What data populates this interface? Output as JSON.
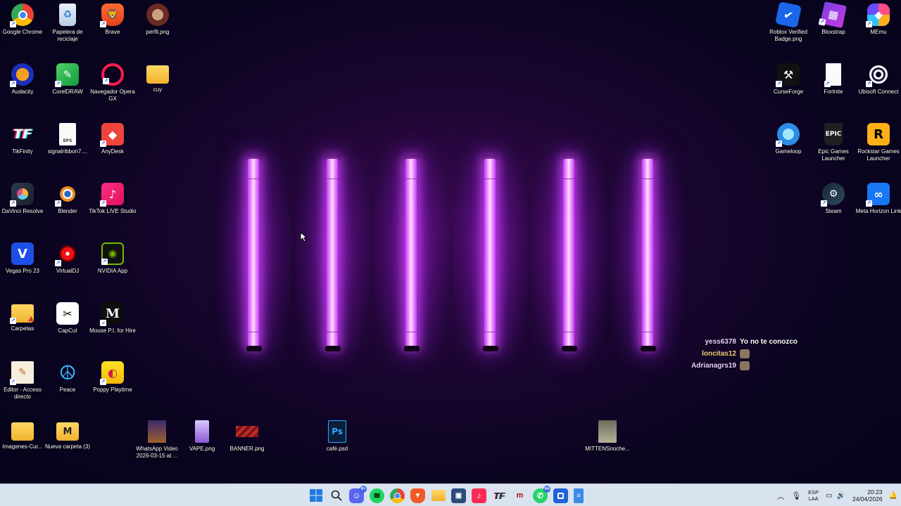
{
  "desktop": {
    "icons_left": [
      {
        "label": "Google Chrome",
        "icon": "chrome-icon"
      },
      {
        "label": "Papelera de reciclaje",
        "icon": "recycle-bin-icon"
      },
      {
        "label": "Brave",
        "icon": "brave-icon"
      },
      {
        "label": "perfil.png",
        "icon": "image-file-icon"
      },
      {
        "label": "Audacity",
        "icon": "audacity-icon"
      },
      {
        "label": "CorelDRAW",
        "icon": "coreldraw-icon"
      },
      {
        "label": "Navegador Opera GX",
        "icon": "opera-gx-icon"
      },
      {
        "label": "cuy",
        "icon": "folder-icon"
      },
      {
        "label": "TikFinity",
        "icon": "tikfinity-icon"
      },
      {
        "label": "signalribbon7....",
        "icon": "eps-file-icon"
      },
      {
        "label": "AnyDesk",
        "icon": "anydesk-icon"
      },
      {
        "label": "DaVinci Resolve",
        "icon": "davinci-resolve-icon"
      },
      {
        "label": "Blender",
        "icon": "blender-icon"
      },
      {
        "label": "TikTok LIVE Studio",
        "icon": "tiktok-live-icon"
      },
      {
        "label": "Vegas Pro 23",
        "icon": "vegas-pro-icon"
      },
      {
        "label": "VirtualDJ",
        "icon": "virtualdj-icon"
      },
      {
        "label": "NVIDIA App",
        "icon": "nvidia-icon"
      },
      {
        "label": "Carpetas",
        "icon": "folder-warning-icon"
      },
      {
        "label": "CapCut",
        "icon": "capcut-icon"
      },
      {
        "label": "Mouse P.I. for Hire",
        "icon": "mouse-pi-icon"
      },
      {
        "label": "Editor - Acceso directo",
        "icon": "editor-icon"
      },
      {
        "label": "Peace",
        "icon": "peace-icon"
      },
      {
        "label": "Poppy Playtime",
        "icon": "poppy-playtime-icon"
      },
      {
        "label": "Imagenes-Cur...",
        "icon": "folder-icon"
      },
      {
        "label": "Nueva carpeta (3)",
        "icon": "folder-m-icon"
      }
    ],
    "icons_bottom": [
      {
        "label": "WhatsApp Video 2026-03-15 at ...",
        "icon": "video-file-icon"
      },
      {
        "label": "VAPE.png",
        "icon": "image-file-icon"
      },
      {
        "label": "BANNER.png",
        "icon": "image-file-icon"
      },
      {
        "label": "café.psd",
        "icon": "psd-file-icon",
        "glyph": "Ps"
      },
      {
        "label": "MITTENSnoche...",
        "icon": "image-file-icon"
      }
    ],
    "icons_right": [
      {
        "label": "Roblox Verified Badge.png",
        "icon": "verified-badge-icon"
      },
      {
        "label": "Bloxstrap",
        "icon": "bloxstrap-icon"
      },
      {
        "label": "MEmu",
        "icon": "memu-icon"
      },
      {
        "label": "CurseForge",
        "icon": "curseforge-icon"
      },
      {
        "label": "Fortnite",
        "icon": "file-icon"
      },
      {
        "label": "Ubisoft Connect",
        "icon": "ubisoft-icon"
      },
      {
        "label": "Gameloop",
        "icon": "gameloop-icon"
      },
      {
        "label": "Epic Games Launcher",
        "icon": "epic-games-icon",
        "glyph": "EPIC"
      },
      {
        "label": "Rockstar Games Launcher",
        "icon": "rockstar-icon",
        "glyph": "R"
      },
      {
        "label": "Steam",
        "icon": "steam-icon"
      },
      {
        "label": "Meta Horizon Link",
        "icon": "meta-icon"
      }
    ],
    "glyphs": {
      "vegas": "V",
      "tikfinity": "TF",
      "capcut": "✂",
      "peace": "☮"
    }
  },
  "chat": [
    {
      "user": "yess6378",
      "message": "Yo no te conozco",
      "user_color": "#e8d0ff"
    },
    {
      "user": "loncitas12",
      "message": "",
      "user_color": "#f5d08a"
    },
    {
      "user": "Adrianagrs19",
      "message": "",
      "user_color": "#e8d0ff"
    }
  ],
  "taskbar": {
    "apps": [
      {
        "name": "start-button",
        "icon": "windows-icon"
      },
      {
        "name": "search-button",
        "icon": "search-icon"
      },
      {
        "name": "discord-button",
        "icon": "discord-icon",
        "badge": "9+"
      },
      {
        "name": "spotify-button",
        "icon": "spotify-icon"
      },
      {
        "name": "chrome-button",
        "icon": "chrome-icon"
      },
      {
        "name": "brave-button",
        "icon": "brave-icon"
      },
      {
        "name": "file-explorer-button",
        "icon": "folder-icon"
      },
      {
        "name": "photos-button",
        "icon": "photos-icon"
      },
      {
        "name": "tiktok-live-button",
        "icon": "tiktok-icon"
      },
      {
        "name": "tikfinity-button",
        "icon": "tikfinity-icon"
      },
      {
        "name": "mouse-pi-button",
        "icon": "mouse-pi-icon"
      },
      {
        "name": "whatsapp-button",
        "icon": "whatsapp-icon",
        "badge": "64"
      },
      {
        "name": "app-button",
        "icon": "app-icon"
      },
      {
        "name": "notepad-button",
        "icon": "notepad-icon"
      }
    ],
    "tray": {
      "lang_top": "ESP",
      "lang_bottom": "LAA",
      "time": "20:23",
      "date": "24/04/2026"
    }
  },
  "colors": {
    "neon": "#e070ff",
    "taskbar": "#d9e3f0"
  }
}
